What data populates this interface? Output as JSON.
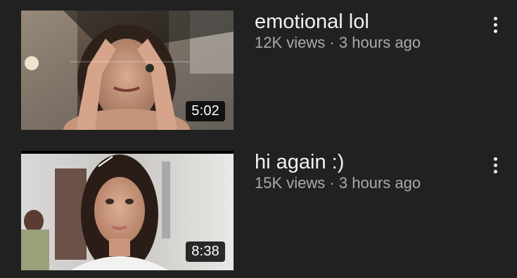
{
  "videos": [
    {
      "title": "emotional lol",
      "views": "12K views",
      "separator": "·",
      "age": "3 hours ago",
      "duration": "5:02",
      "thumbnail": "woman-framing-eyes-with-hands",
      "menu_icon": "more-vert-icon"
    },
    {
      "title": "hi again :)",
      "views": "15K views",
      "separator": "·",
      "age": "3 hours ago",
      "duration": "8:38",
      "thumbnail": "woman-in-bathroom-selfie",
      "menu_icon": "more-vert-icon"
    }
  ],
  "colors": {
    "background": "#212121",
    "title_text": "#f1f1f1",
    "meta_text": "#aaaaaa",
    "duration_bg": "#000000"
  }
}
